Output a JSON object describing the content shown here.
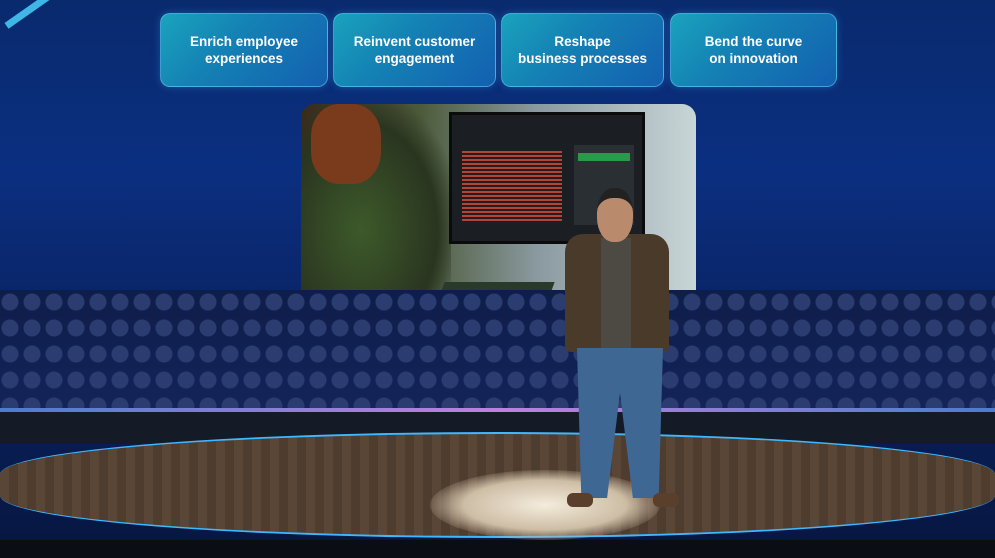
{
  "banner_cards": [
    {
      "label": "Enrich employee\nexperiences"
    },
    {
      "label": "Reinvent customer\nengagement"
    },
    {
      "label": "Reshape\nbusiness processes"
    },
    {
      "label": "Bend the curve\non innovation"
    }
  ]
}
